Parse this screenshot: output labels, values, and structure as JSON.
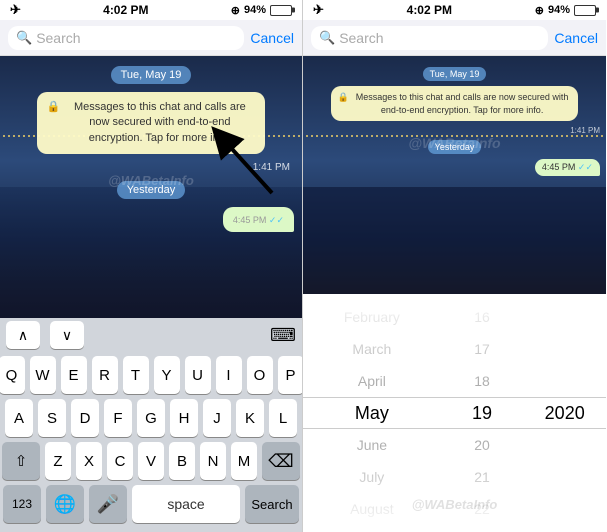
{
  "left_panel": {
    "status": {
      "time": "4:02 PM",
      "signal": "⊕ 94%"
    },
    "search": {
      "placeholder": "Search",
      "cancel": "Cancel"
    },
    "chat": {
      "date_pill": "Tue, May 19",
      "system_msg": "Messages to this chat and calls are now secured with end-to-end encryption. Tap for more info.",
      "yesterday_pill": "Yesterday",
      "sent_time": "4:45 PM"
    },
    "keyboard": {
      "row1": [
        "Q",
        "W",
        "E",
        "R",
        "T",
        "Y",
        "U",
        "I",
        "O",
        "P"
      ],
      "row2": [
        "A",
        "S",
        "D",
        "F",
        "G",
        "H",
        "J",
        "K",
        "L"
      ],
      "row3": [
        "Z",
        "X",
        "C",
        "V",
        "B",
        "N",
        "M"
      ],
      "space": "space",
      "search_key": "Search",
      "num_key": "123",
      "delete": "⌫",
      "shift": "⇧",
      "emoji": "🌐",
      "mic": "🎤"
    },
    "nav": {
      "up": "∧",
      "down": "∨"
    },
    "watermark": "@WABetaInfo"
  },
  "right_panel": {
    "status": {
      "time": "4:02 PM",
      "signal": "⊕ 94%"
    },
    "search": {
      "placeholder": "Search",
      "cancel": "Cancel"
    },
    "chat": {
      "date_pill": "Tue, May 19",
      "system_msg": "Messages to this chat and calls are now secured with end-to-end encryption. Tap for more info.",
      "yesterday_pill": "Yesterday",
      "sent_time": "4:45 PM"
    },
    "watermark_chat": "@WABetaInfo",
    "watermark_drum": "@WABetaInfo",
    "date_picker": {
      "months": [
        "February",
        "March",
        "April",
        "May",
        "June",
        "July",
        "August"
      ],
      "days": [
        "16",
        "17",
        "18",
        "19",
        "20",
        "21",
        "22"
      ],
      "years": [
        "2020"
      ],
      "selected_month": "May",
      "selected_day": "19",
      "selected_year": "2020"
    }
  }
}
